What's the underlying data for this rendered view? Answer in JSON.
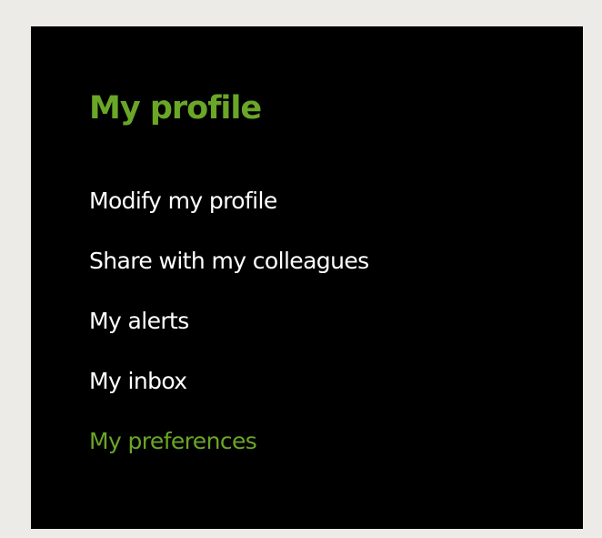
{
  "profile_menu": {
    "title": "My profile",
    "items": [
      {
        "label": "Modify my profile",
        "active": false
      },
      {
        "label": "Share with my colleagues",
        "active": false
      },
      {
        "label": "My alerts",
        "active": false
      },
      {
        "label": "My inbox",
        "active": false
      },
      {
        "label": "My preferences",
        "active": true
      }
    ]
  },
  "colors": {
    "page_background": "#ecebe7",
    "panel_background": "#000000",
    "accent": "#6aa627",
    "text": "#ffffff"
  }
}
